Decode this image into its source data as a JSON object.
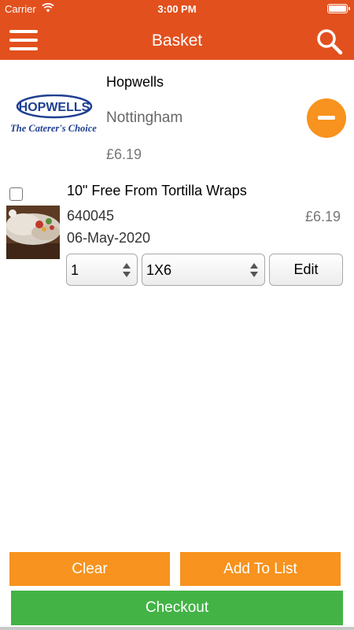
{
  "status_bar": {
    "carrier": "Carrier",
    "time": "3:00 PM"
  },
  "nav": {
    "title": "Basket",
    "menu_icon": "hamburger-menu-icon",
    "search_icon": "magnifier-icon"
  },
  "supplier": {
    "logo_text": "HOPWELLS",
    "logo_tagline": "The Caterer's Choice",
    "name": "Hopwells",
    "location": "Nottingham",
    "total": "£6.19",
    "remove_icon": "minus-circle-icon"
  },
  "items": [
    {
      "title": "10\" Free From Tortilla Wraps",
      "code": "640045",
      "date": "06-May-2020",
      "price": "£6.19",
      "quantity": "1",
      "pack": "1X6",
      "edit_label": "Edit",
      "checked": false
    }
  ],
  "actions": {
    "clear_label": "Clear",
    "add_to_list_label": "Add To List",
    "checkout_label": "Checkout"
  },
  "colors": {
    "header": "#e2501e",
    "accent_orange": "#f7931e",
    "checkout_green": "#43b346"
  }
}
